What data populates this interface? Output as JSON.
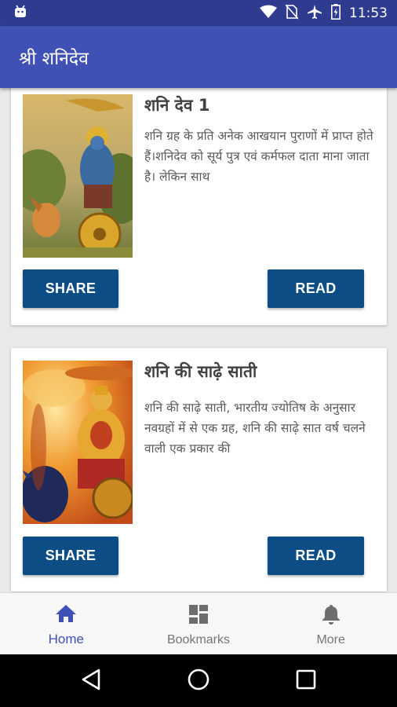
{
  "status_bar": {
    "time": "11:53",
    "icons": [
      "android-icon",
      "wifi-icon",
      "no-sim-icon",
      "airplane-icon",
      "battery-charging-icon"
    ]
  },
  "app_bar": {
    "title": "श्री शनिदेव"
  },
  "cards": [
    {
      "title": "शनि देव 1",
      "description": "शनि ग्रह के प्रति अनेक आखयान पुराणों में प्राप्त होते हैं।शनिदेव को सूर्य पुत्र एवं कर्मफल दाता माना जाता है। लेकिन साथ",
      "share_label": "SHARE",
      "read_label": "READ"
    },
    {
      "title": "शनि की साढ़े साती",
      "description": "शनि की साढ़े साती, भारतीय ज्योतिष के अनुसार नवग्रहों में से एक ग्रह, शनि की साढ़े सात वर्ष चलने वाली एक प्रकार की",
      "share_label": "SHARE",
      "read_label": "READ"
    }
  ],
  "bottom_nav": {
    "items": [
      {
        "label": "Home",
        "icon": "home-icon",
        "active": true
      },
      {
        "label": "Bookmarks",
        "icon": "dashboard-icon",
        "active": false
      },
      {
        "label": "More",
        "icon": "bell-icon",
        "active": false
      }
    ]
  },
  "colors": {
    "status_bar": "#2e3b8f",
    "app_bar": "#3f51b5",
    "button": "#0d4d86",
    "active_nav": "#3f51b5",
    "inactive_nav": "#757575"
  },
  "system_nav": {
    "icons": [
      "back-icon",
      "home-circle-icon",
      "recents-icon"
    ]
  }
}
